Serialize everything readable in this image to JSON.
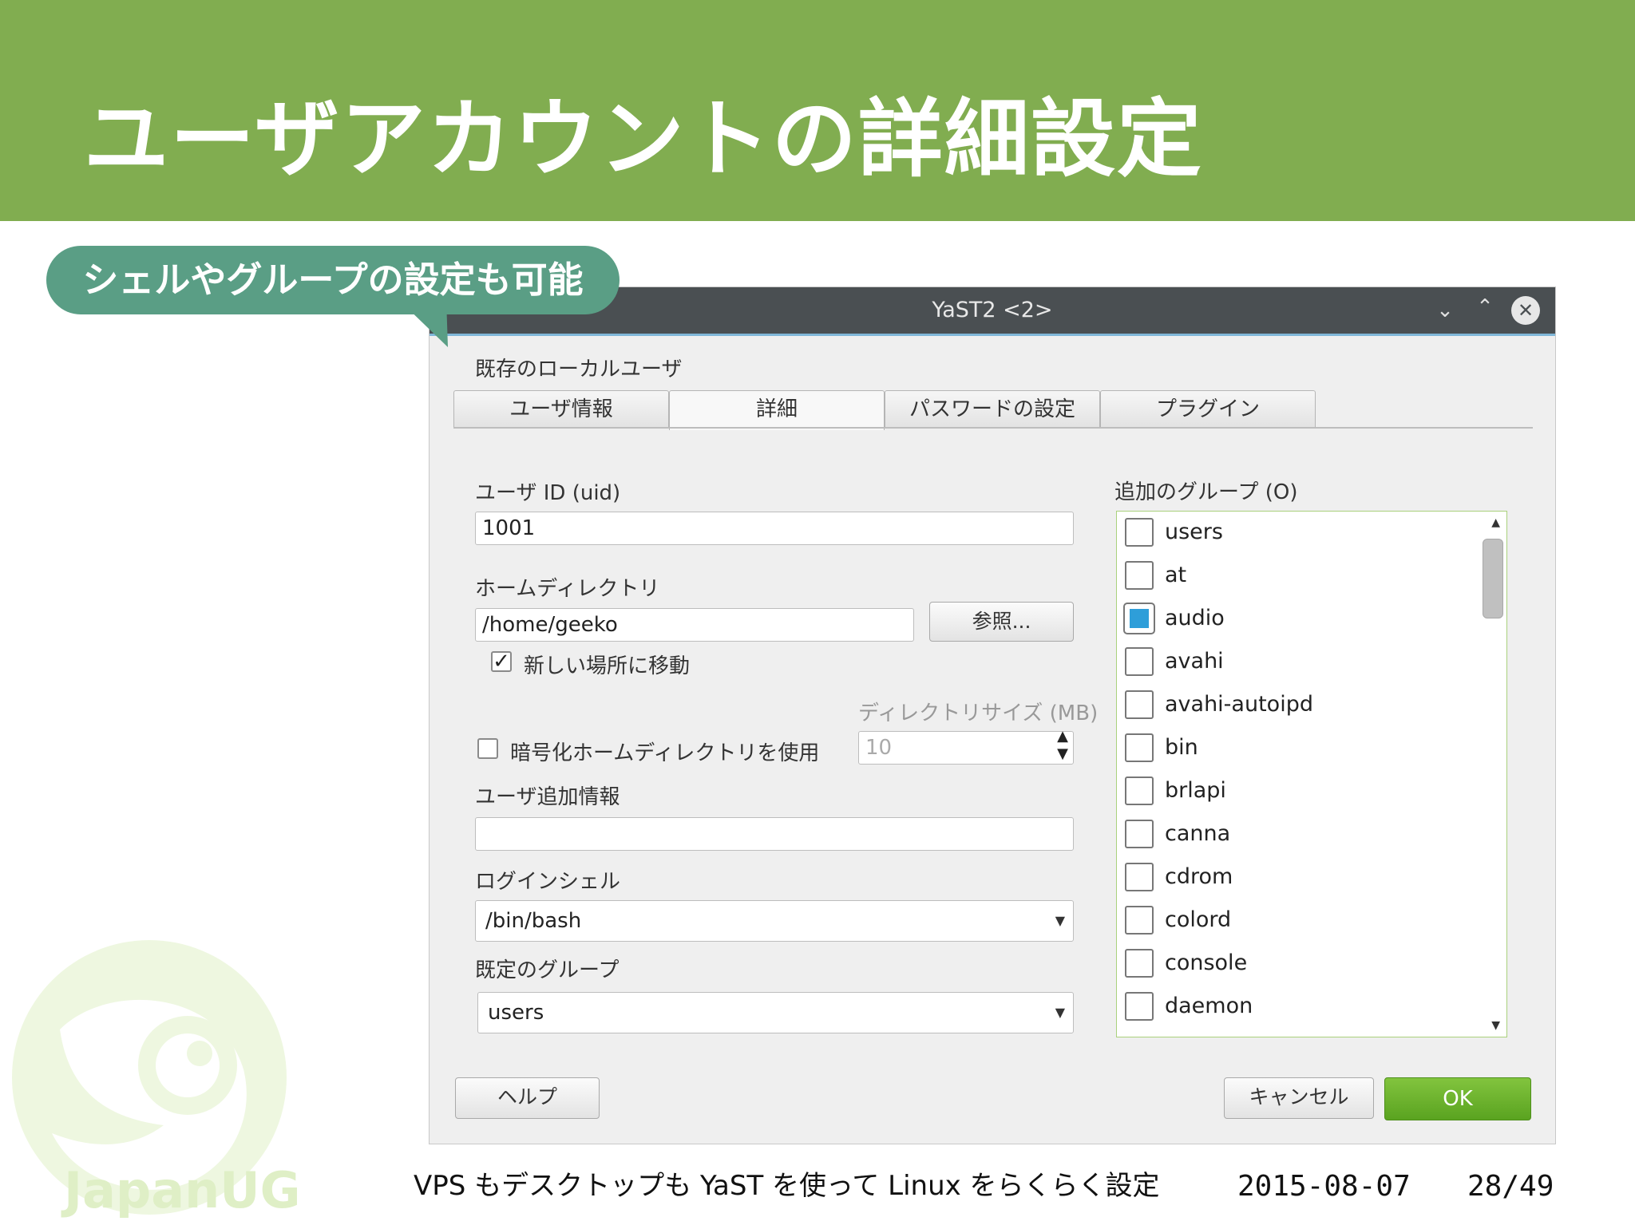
{
  "slide": {
    "title": "ユーザアカウントの詳細設定",
    "callout": "シェルやグループの設定も可能",
    "logo_text": "JapanUG",
    "footer_caption": "VPS もデスクトップも YaST を使って Linux をらくらく設定",
    "footer_date": "2015-08-07",
    "footer_page": "28/49"
  },
  "colors": {
    "header_bg": "#81ad50",
    "callout_bg": "#5a9e85",
    "titlebar_bg": "#4a4f52",
    "ok_button": "#6ab32a",
    "checked_group": "#2e9ed9"
  },
  "window": {
    "title": "YaST2 <2>",
    "controls": {
      "minimize_icon": "chevron-down-icon",
      "maximize_icon": "chevron-up-icon",
      "close_icon": "close-icon"
    },
    "section_title": "既存のローカルユーザ",
    "tabs": [
      {
        "label": "ユーザ情報",
        "active": false
      },
      {
        "label": "詳細",
        "active": true
      },
      {
        "label": "パスワードの設定",
        "active": false
      },
      {
        "label": "プラグイン",
        "active": false
      }
    ],
    "form": {
      "uid_label": "ユーザ ID (uid)",
      "uid_value": "1001",
      "home_label": "ホームディレクトリ",
      "home_value": "/home/geeko",
      "browse_button": "参照...",
      "move_checkbox_label": "新しい場所に移動",
      "move_checked": true,
      "dir_size_label": "ディレクトリサイズ (MB)",
      "dir_size_value": "10",
      "encrypt_checkbox_label": "暗号化ホームディレクトリを使用",
      "encrypt_checked": false,
      "extra_info_label": "ユーザ追加情報",
      "extra_info_value": "",
      "shell_label": "ログインシェル",
      "shell_value": "/bin/bash",
      "default_group_label": "既定のグループ",
      "default_group_value": "users"
    },
    "groups": {
      "label": "追加のグループ (O)",
      "items": [
        {
          "name": "users",
          "checked": false
        },
        {
          "name": "at",
          "checked": false
        },
        {
          "name": "audio",
          "checked": true
        },
        {
          "name": "avahi",
          "checked": false
        },
        {
          "name": "avahi-autoipd",
          "checked": false
        },
        {
          "name": "bin",
          "checked": false
        },
        {
          "name": "brlapi",
          "checked": false
        },
        {
          "name": "canna",
          "checked": false
        },
        {
          "name": "cdrom",
          "checked": false
        },
        {
          "name": "colord",
          "checked": false
        },
        {
          "name": "console",
          "checked": false
        },
        {
          "name": "daemon",
          "checked": false
        }
      ]
    },
    "buttons": {
      "help": "ヘルプ",
      "cancel": "キャンセル",
      "ok": "OK"
    }
  }
}
